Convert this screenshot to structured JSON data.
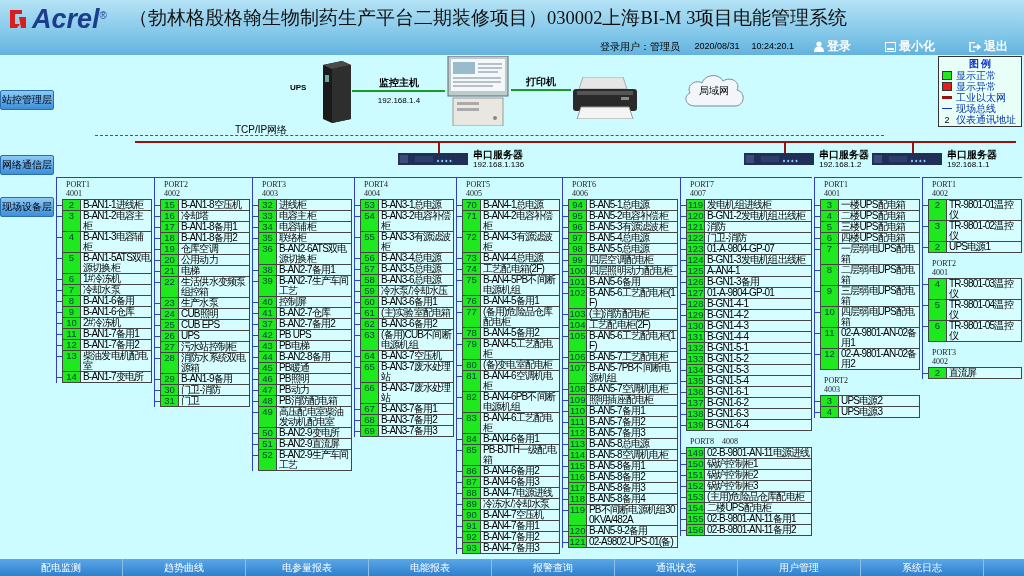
{
  "header": {
    "logo": "Acrel",
    "logo_mark": "®",
    "title": "（勃林格殷格翰生物制药生产平台二期装修项目）030002上海BI-M 3项目电能管理系统"
  },
  "login": {
    "label": "登录用户：",
    "user": "管理员",
    "date": "2020/08/31",
    "time": "10:24:20.1"
  },
  "header_buttons": [
    {
      "kind": "login",
      "label": "登录"
    },
    {
      "kind": "minimize",
      "label": "最小化"
    },
    {
      "kind": "exit",
      "label": "退出"
    }
  ],
  "layers": [
    "站控管理层",
    "网络通信层",
    "现场设备层"
  ],
  "station": {
    "ups": "UPS",
    "host": {
      "label": "监控主机",
      "ip": "192.168.1.4"
    },
    "printer": "打印机",
    "lan": "局域网",
    "network": "TCP/IP网络"
  },
  "legend": {
    "title": "图 例",
    "items": [
      {
        "kind": "normal",
        "label": "显示正常"
      },
      {
        "kind": "fault",
        "label": "显示异常"
      },
      {
        "kind": "ethernet",
        "label": "工业以太网"
      },
      {
        "kind": "fieldbus",
        "label": "现场总线"
      },
      {
        "kind": "address",
        "symbol": "2",
        "label": "仪表通讯地址"
      }
    ]
  },
  "servers": [
    {
      "label": "串口服务器",
      "ip": "192.168.1.136",
      "ports": [
        {
          "name": "PORT1",
          "number": "4001",
          "items": [
            {
              "addr": "2",
              "name": "B-AN1-1进线柜",
              "online": true
            },
            {
              "addr": "3",
              "name": "B-AN1-2电容主柜",
              "online": true
            },
            {
              "addr": "4",
              "name": "B-AN1-3电容辅柜",
              "online": true
            },
            {
              "addr": "5",
              "name": "B-AN1-5ATS双电源切换柜",
              "online": true
            },
            {
              "addr": "6",
              "name": "1#冷冻机",
              "online": true
            },
            {
              "addr": "7",
              "name": "冷却水泵",
              "online": true
            },
            {
              "addr": "8",
              "name": "B-AN1-6备用",
              "online": true
            },
            {
              "addr": "9",
              "name": "B-AN1-6仓库",
              "online": true
            },
            {
              "addr": "10",
              "name": "2#冷冻机",
              "online": true
            },
            {
              "addr": "11",
              "name": "B-AN1-7备用1",
              "online": true
            },
            {
              "addr": "12",
              "name": "B-AN1-7备用2",
              "online": true
            },
            {
              "addr": "13",
              "name": "柴油发电机配电室",
              "online": true
            },
            {
              "addr": "14",
              "name": "B-AN1-7变电所",
              "online": true
            }
          ]
        },
        {
          "name": "PORT2",
          "number": "4002",
          "items": [
            {
              "addr": "15",
              "name": "B-AN1-8空压机",
              "online": true
            },
            {
              "addr": "16",
              "name": "冷却塔",
              "online": true
            },
            {
              "addr": "17",
              "name": "B-AN1-8备用1",
              "online": true
            },
            {
              "addr": "18",
              "name": "B-AN1-8备用2",
              "online": true
            },
            {
              "addr": "19",
              "name": "仓库空调",
              "online": true
            },
            {
              "addr": "20",
              "name": "公用动力",
              "online": true
            },
            {
              "addr": "21",
              "name": "电梯",
              "online": true
            },
            {
              "addr": "22",
              "name": "生活供水变频泵组控箱",
              "online": true
            },
            {
              "addr": "23",
              "name": "生产水泵",
              "online": true
            },
            {
              "addr": "24",
              "name": "CUB照明",
              "online": true
            },
            {
              "addr": "25",
              "name": "CUB EPS",
              "online": true
            },
            {
              "addr": "26",
              "name": "UPS",
              "online": true
            },
            {
              "addr": "27",
              "name": "污水站控制柜",
              "online": true
            },
            {
              "addr": "28",
              "name": "消防水系统双电源箱",
              "online": true
            },
            {
              "addr": "29",
              "name": "B-AN1-9备用",
              "online": true
            },
            {
              "addr": "30",
              "name": "门卫-消防",
              "online": true
            },
            {
              "addr": "31",
              "name": "门卫",
              "online": true
            }
          ]
        },
        {
          "name": "PORT3",
          "number": "4003",
          "items": [
            {
              "addr": "32",
              "name": "进线柜",
              "online": true
            },
            {
              "addr": "33",
              "name": "电容主柜",
              "online": true
            },
            {
              "addr": "34",
              "name": "电容辅柜",
              "online": true
            },
            {
              "addr": "35",
              "name": "联络柜",
              "online": true
            },
            {
              "addr": "36",
              "name": "B-AN2-6ATS双电源切换柜",
              "online": true
            },
            {
              "addr": "38",
              "name": "B-AN2-7备用1",
              "online": true
            },
            {
              "addr": "39",
              "name": "B-AN2-7生产车间工艺",
              "online": true
            },
            {
              "addr": "40",
              "name": "控制屏",
              "online": true
            },
            {
              "addr": "41",
              "name": "B-AN2-7仓库",
              "online": true
            },
            {
              "addr": "37",
              "name": "B-AN2-7备用2",
              "online": true
            },
            {
              "addr": "42",
              "name": "PB UPS",
              "online": true
            },
            {
              "addr": "43",
              "name": "PB电梯",
              "online": true
            },
            {
              "addr": "44",
              "name": "B-AN2-8备用",
              "online": true
            },
            {
              "addr": "45",
              "name": "PB暖通",
              "online": true
            },
            {
              "addr": "46",
              "name": "PB照明",
              "online": true
            },
            {
              "addr": "47",
              "name": "PB动力",
              "online": true
            },
            {
              "addr": "48",
              "name": "PB消防配电箱",
              "online": true
            },
            {
              "addr": "49",
              "name": "高压配电室柴油发动机配电室",
              "online": true
            },
            {
              "addr": "50",
              "name": "B-AN2-9变电所",
              "online": true
            },
            {
              "addr": "51",
              "name": "B-AN2-9直流屏",
              "online": true
            },
            {
              "addr": "52",
              "name": "B-AN2-9生产车间工艺",
              "online": true
            }
          ]
        },
        {
          "name": "PORT4",
          "number": "4004",
          "items": [
            {
              "addr": "53",
              "name": "B-AN3-1总电源",
              "online": true
            },
            {
              "addr": "54",
              "name": "B-AN3-2电容补偿柜",
              "online": true
            },
            {
              "addr": "55",
              "name": "B-AN3-3有源滤波柜",
              "online": true
            },
            {
              "addr": "56",
              "name": "B-AN3-4总电源",
              "online": true
            },
            {
              "addr": "57",
              "name": "B-AN3-5总电源",
              "online": true
            },
            {
              "addr": "58",
              "name": "B-AN3-6总电源",
              "online": true
            },
            {
              "addr": "59",
              "name": "冷水泵/冷却水压",
              "online": true
            },
            {
              "addr": "60",
              "name": "B-AN3-6备用1",
              "online": true
            },
            {
              "addr": "61",
              "name": "(主)实验室配电箱",
              "online": true
            },
            {
              "addr": "62",
              "name": "B-AN3-6备用2",
              "online": true
            },
            {
              "addr": "63",
              "name": "(备用)CUB不间断电源机组",
              "online": true
            },
            {
              "addr": "64",
              "name": "B-AN3-7空压机",
              "online": true
            },
            {
              "addr": "65",
              "name": "B-AN3-7废水处理站",
              "online": true
            },
            {
              "addr": "66",
              "name": "B-AN3-7废水处理站",
              "online": true
            },
            {
              "addr": "67",
              "name": "B-AN3-7备用1",
              "online": true
            },
            {
              "addr": "68",
              "name": "B-AN3-7备用2",
              "online": true
            },
            {
              "addr": "69",
              "name": "B-AN3-7备用3",
              "online": true
            }
          ]
        },
        {
          "name": "PORT5",
          "number": "4005",
          "items": [
            {
              "addr": "70",
              "name": "B-AN4-1总电源",
              "online": true
            },
            {
              "addr": "71",
              "name": "B-AN4-2电容补偿柜",
              "online": true
            },
            {
              "addr": "72",
              "name": "B-AN4-3有源滤波柜",
              "online": true
            },
            {
              "addr": "73",
              "name": "B-AN4-4总电源",
              "online": true
            },
            {
              "addr": "74",
              "name": "工艺配电箱(2F)",
              "online": true
            },
            {
              "addr": "75",
              "name": "B-AN4-5PB不间断电源机组",
              "online": true
            },
            {
              "addr": "76",
              "name": "B-AN4-5备用1",
              "online": true
            },
            {
              "addr": "77",
              "name": "(备用)危险品仓库配电柜",
              "online": true
            },
            {
              "addr": "78",
              "name": "B-AN4-5备用2",
              "online": true
            },
            {
              "addr": "79",
              "name": "B-AN4-5工艺配电柜",
              "online": true
            },
            {
              "addr": "80",
              "name": "(备)变电室配电柜",
              "online": true
            },
            {
              "addr": "81",
              "name": "B-AN4-6空调机电柜",
              "online": true
            },
            {
              "addr": "82",
              "name": "B-AN4-6PB不间断电源机组",
              "online": true
            },
            {
              "addr": "83",
              "name": "B-AN4-6工艺配电柜",
              "online": true
            },
            {
              "addr": "84",
              "name": "B-AN4-6备用1",
              "online": true
            },
            {
              "addr": "85",
              "name": "PB-BJTH一级配电箱",
              "online": true
            },
            {
              "addr": "86",
              "name": "B-AN4-6备用2",
              "online": true
            },
            {
              "addr": "87",
              "name": "B-AN4-6备用3",
              "online": true
            },
            {
              "addr": "88",
              "name": "B-AN4-7电源进线",
              "online": true
            },
            {
              "addr": "89",
              "name": "冷冻水/冷却水泵",
              "online": true
            },
            {
              "addr": "90",
              "name": "B-AN4-7空压机",
              "online": true
            },
            {
              "addr": "91",
              "name": "B-AN4-7备用1",
              "online": true
            },
            {
              "addr": "92",
              "name": "B-AN4-7备用2",
              "online": true
            },
            {
              "addr": "93",
              "name": "B-AN4-7备用3",
              "online": true
            }
          ]
        },
        {
          "name": "PORT6",
          "number": "4006",
          "items": [
            {
              "addr": "94",
              "name": "B-AN5-1总电源",
              "online": true
            },
            {
              "addr": "95",
              "name": "B-AN5-2电容补偿柜",
              "online": true
            },
            {
              "addr": "96",
              "name": "B-AN5-3有源滤波柜",
              "online": true
            },
            {
              "addr": "97",
              "name": "B-AN5-4总电源",
              "online": true
            },
            {
              "addr": "98",
              "name": "B-AN5-5总电源",
              "online": true
            },
            {
              "addr": "99",
              "name": "四层空调配电柜",
              "online": true
            },
            {
              "addr": "100",
              "name": "四层照明动力配电柜",
              "online": true
            },
            {
              "addr": "101",
              "name": "B-AN5-6备用",
              "online": true
            },
            {
              "addr": "102",
              "name": "B-AN5-6工艺配电柜(1F)",
              "online": true
            },
            {
              "addr": "103",
              "name": "(主)消防配电柜",
              "online": true
            },
            {
              "addr": "104",
              "name": "工艺配电柜(2F)",
              "online": true
            },
            {
              "addr": "105",
              "name": "B-AN5-6工艺配电柜(1F)",
              "online": true
            },
            {
              "addr": "106",
              "name": "B-AN5-7工艺配电柜",
              "online": true
            },
            {
              "addr": "107",
              "name": "B-AN5-7PB不间断电源机组",
              "online": true
            },
            {
              "addr": "108",
              "name": "B-AN5-7空调机电柜",
              "online": true
            },
            {
              "addr": "109",
              "name": "照明插座配电柜",
              "online": true
            },
            {
              "addr": "110",
              "name": "B-AN5-7备用1",
              "online": true
            },
            {
              "addr": "111",
              "name": "B-AN5-7备用2",
              "online": true
            },
            {
              "addr": "112",
              "name": "B-AN5-7备用3",
              "online": true
            },
            {
              "addr": "113",
              "name": "B-AN5-8总电源",
              "online": true
            },
            {
              "addr": "114",
              "name": "B-AN5-8空调机电柜",
              "online": true
            },
            {
              "addr": "115",
              "name": "B-AN5-8备用1",
              "online": true
            },
            {
              "addr": "116",
              "name": "B-AN5-8备用2",
              "online": true
            },
            {
              "addr": "117",
              "name": "B-AN5-8备用3",
              "online": true
            },
            {
              "addr": "118",
              "name": "B-AN5-8备用4",
              "online": true
            },
            {
              "addr": "119",
              "name": "PB不间断电源机组300KVA/482A",
              "online": true
            },
            {
              "addr": "120",
              "name": "B-AN5-9-2备用",
              "online": true
            },
            {
              "addr": "121",
              "name": "02-A9802-UPS-01(备)",
              "online": true
            }
          ]
        },
        {
          "name": "PORT7",
          "number": "4007",
          "items": [
            {
              "addr": "119",
              "name": "发电机组进线柜",
              "online": true
            },
            {
              "addr": "120",
              "name": "B-GN1-2发电机组出线柜",
              "online": true
            },
            {
              "addr": "121",
              "name": "消防",
              "online": true
            },
            {
              "addr": "122",
              "name": "门卫-消防",
              "online": true
            },
            {
              "addr": "123",
              "name": "01-A-9804-GP-07",
              "online": true
            },
            {
              "addr": "124",
              "name": "B-GN1-3发电机组出线柜",
              "online": true
            },
            {
              "addr": "125",
              "name": "A-AN4-1",
              "online": true
            },
            {
              "addr": "126",
              "name": "B-GN1-3备用",
              "online": true
            },
            {
              "addr": "127",
              "name": "01-A-9804-GP-01",
              "online": true
            },
            {
              "addr": "128",
              "name": "B-GN1-4-1",
              "online": true
            },
            {
              "addr": "129",
              "name": "B-GN1-4-2",
              "online": true
            },
            {
              "addr": "130",
              "name": "B-GN1-4-3",
              "online": true
            },
            {
              "addr": "131",
              "name": "B-GN1-4-4",
              "online": true
            },
            {
              "addr": "132",
              "name": "B-GN1-5-1",
              "online": true
            },
            {
              "addr": "133",
              "name": "B-GN1-5-2",
              "online": true
            },
            {
              "addr": "134",
              "name": "B-GN1-5-3",
              "online": true
            },
            {
              "addr": "135",
              "name": "B-GN1-5-4",
              "online": true
            },
            {
              "addr": "136",
              "name": "B-GN1-6-1",
              "online": true
            },
            {
              "addr": "137",
              "name": "B-GN1-6-2",
              "online": true
            },
            {
              "addr": "138",
              "name": "B-GN1-6-3",
              "online": true
            },
            {
              "addr": "139",
              "name": "B-GN1-6-4",
              "online": true
            }
          ]
        },
        {
          "name": "PORT8",
          "number": "4008",
          "one_line": true,
          "items": [
            {
              "addr": "149",
              "name": "02-B-9801-AN-11电源进线",
              "online": true
            },
            {
              "addr": "150",
              "name": "锅炉控制柜1",
              "online": true
            },
            {
              "addr": "151",
              "name": "锅炉控制柜2",
              "online": true
            },
            {
              "addr": "152",
              "name": "锅炉控制柜3",
              "online": true
            },
            {
              "addr": "153",
              "name": "(主用)危险品仓库配电柜",
              "online": true
            },
            {
              "addr": "154",
              "name": "二楼UPS配电柜",
              "online": true
            },
            {
              "addr": "155",
              "name": "02-B-9801-AN-11备用1",
              "online": true
            },
            {
              "addr": "156",
              "name": "02-B-9801-AN-11备用2",
              "online": true
            }
          ]
        }
      ]
    },
    {
      "label": "串口服务器",
      "ip": "192.168.1.2",
      "ports": [
        {
          "name": "PORT1",
          "number": "4001",
          "items": [
            {
              "addr": "3",
              "name": "一楼UPS配电箱",
              "online": true
            },
            {
              "addr": "4",
              "name": "二楼UPS配电箱",
              "online": true
            },
            {
              "addr": "5",
              "name": "三楼UPS配电箱",
              "online": true
            },
            {
              "addr": "6",
              "name": "四楼UPS配电箱",
              "online": true
            },
            {
              "addr": "7",
              "name": "一层弱电UPS配电箱",
              "online": true
            },
            {
              "addr": "8",
              "name": "二层弱电UPS配电箱",
              "online": true
            },
            {
              "addr": "9",
              "name": "三层弱电UPS配电箱",
              "online": true
            },
            {
              "addr": "10",
              "name": "四层弱电UPS配电箱",
              "online": true
            },
            {
              "addr": "11",
              "name": "02-A-9801-AN-02备用1",
              "online": true
            },
            {
              "addr": "12",
              "name": "02-A-9801-AN-02备用2",
              "online": true
            }
          ]
        },
        {
          "name": "PORT2",
          "number": "4003",
          "items": [
            {
              "addr": "3",
              "name": "UPS电源2",
              "online": true
            },
            {
              "addr": "4",
              "name": "UPS电源3",
              "online": true
            }
          ]
        }
      ]
    },
    {
      "label": "串口服务器",
      "ip": "192.168.1.1",
      "ports": [
        {
          "name": "PORT1",
          "number": "4002",
          "items": [
            {
              "addr": "2",
              "name": "TR-9801-01温控仪",
              "online": true
            },
            {
              "addr": "3",
              "name": "TR-9801-02温控仪",
              "online": true
            },
            {
              "addr": "2",
              "name": "UPS电源1",
              "online": true
            }
          ]
        },
        {
          "name": "PORT2",
          "number": "4001",
          "items": [
            {
              "addr": "4",
              "name": "TR-9801-03温控仪",
              "online": true
            },
            {
              "addr": "5",
              "name": "TR-9801-04温控仪",
              "online": true
            },
            {
              "addr": "6",
              "name": "TR-9801-05温控仪",
              "online": true
            }
          ]
        },
        {
          "name": "PORT3",
          "number": "4002",
          "items": [
            {
              "addr": "2",
              "name": "直流屏",
              "online": true
            }
          ]
        }
      ]
    }
  ],
  "nav": [
    "配电监测",
    "趋势曲线",
    "电参量报表",
    "电能报表",
    "报警查询",
    "通讯状态",
    "用户管理",
    "系统日志"
  ]
}
